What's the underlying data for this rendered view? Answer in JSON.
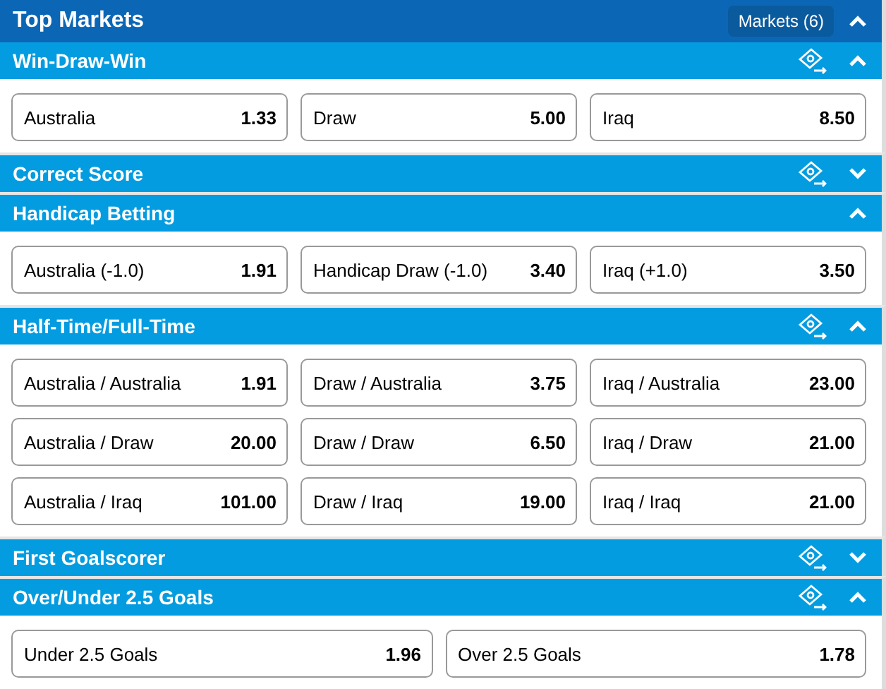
{
  "header": {
    "title": "Top Markets",
    "markets_button": "Markets (6)",
    "expanded": true
  },
  "sections": [
    {
      "title": "Win-Draw-Win",
      "cashout": true,
      "expanded": true,
      "rows": [
        [
          {
            "label": "Australia",
            "odds": "1.33"
          },
          {
            "label": "Draw",
            "odds": "5.00"
          },
          {
            "label": "Iraq",
            "odds": "8.50"
          }
        ]
      ]
    },
    {
      "title": "Correct Score",
      "cashout": true,
      "expanded": false
    },
    {
      "title": "Handicap Betting",
      "cashout": false,
      "expanded": true,
      "rows": [
        [
          {
            "label": "Australia (-1.0)",
            "odds": "1.91"
          },
          {
            "label": "Handicap Draw (-1.0)",
            "odds": "3.40"
          },
          {
            "label": "Iraq (+1.0)",
            "odds": "3.50"
          }
        ]
      ]
    },
    {
      "title": "Half-Time/Full-Time",
      "cashout": true,
      "expanded": true,
      "rows": [
        [
          {
            "label": "Australia / Australia",
            "odds": "1.91"
          },
          {
            "label": "Draw / Australia",
            "odds": "3.75"
          },
          {
            "label": "Iraq / Australia",
            "odds": "23.00"
          }
        ],
        [
          {
            "label": "Australia / Draw",
            "odds": "20.00"
          },
          {
            "label": "Draw / Draw",
            "odds": "6.50"
          },
          {
            "label": "Iraq / Draw",
            "odds": "21.00"
          }
        ],
        [
          {
            "label": "Australia / Iraq",
            "odds": "101.00"
          },
          {
            "label": "Draw / Iraq",
            "odds": "19.00"
          },
          {
            "label": "Iraq / Iraq",
            "odds": "21.00"
          }
        ]
      ]
    },
    {
      "title": "First Goalscorer",
      "cashout": true,
      "expanded": false
    },
    {
      "title": "Over/Under 2.5 Goals",
      "cashout": true,
      "expanded": true,
      "rows": [
        [
          {
            "label": "Under 2.5 Goals",
            "odds": "1.96"
          },
          {
            "label": "Over 2.5 Goals",
            "odds": "1.78"
          }
        ]
      ]
    }
  ]
}
